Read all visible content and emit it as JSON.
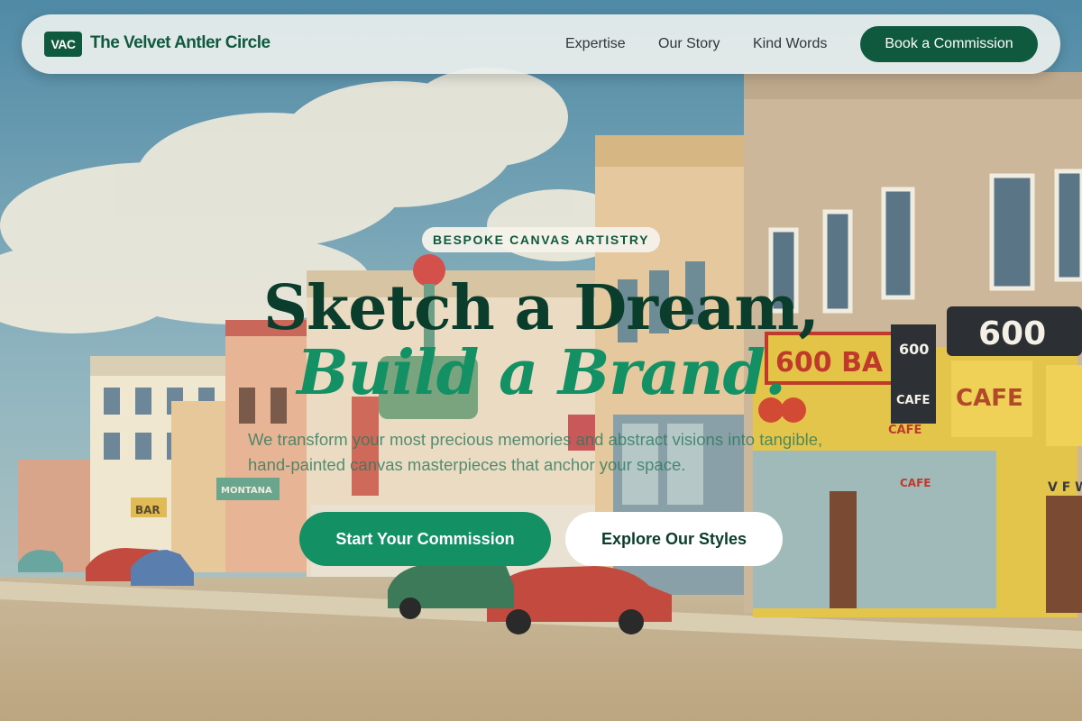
{
  "header": {
    "logo_badge": "VAC",
    "brand_name": "The Velvet Antler Circle",
    "nav": [
      "Expertise",
      "Our Story",
      "Kind Words"
    ],
    "cta_label": "Book a Commission"
  },
  "hero": {
    "eyebrow": "BESPOKE CANVAS ARTISTRY",
    "headline_line1": "Sketch a Dream,",
    "headline_line2": "Build a Brand.",
    "subtitle": "We transform your most precious memories and abstract visions into tangible, hand-painted canvas masterpieces that anchor your space.",
    "primary_button": "Start Your Commission",
    "secondary_button": "Explore Our Styles",
    "background_signs": {
      "sign_600_bar": "600 BA",
      "sign_600_top": "600",
      "sign_600_small": "600",
      "sign_cafe_1": "CAFE",
      "sign_cafe_2": "CAFE",
      "sign_cafe_3": "CAFE",
      "sign_cafe_4": "CAFE",
      "sign_vfw": "V F W",
      "sign_bar_left": "BAR",
      "sign_montana": "MONTANA"
    }
  },
  "colors": {
    "brand_green": "#0f5a3e",
    "accent_green": "#139064",
    "headline_dark": "#0b3d2c",
    "header_bg": "#ecf0ee"
  }
}
